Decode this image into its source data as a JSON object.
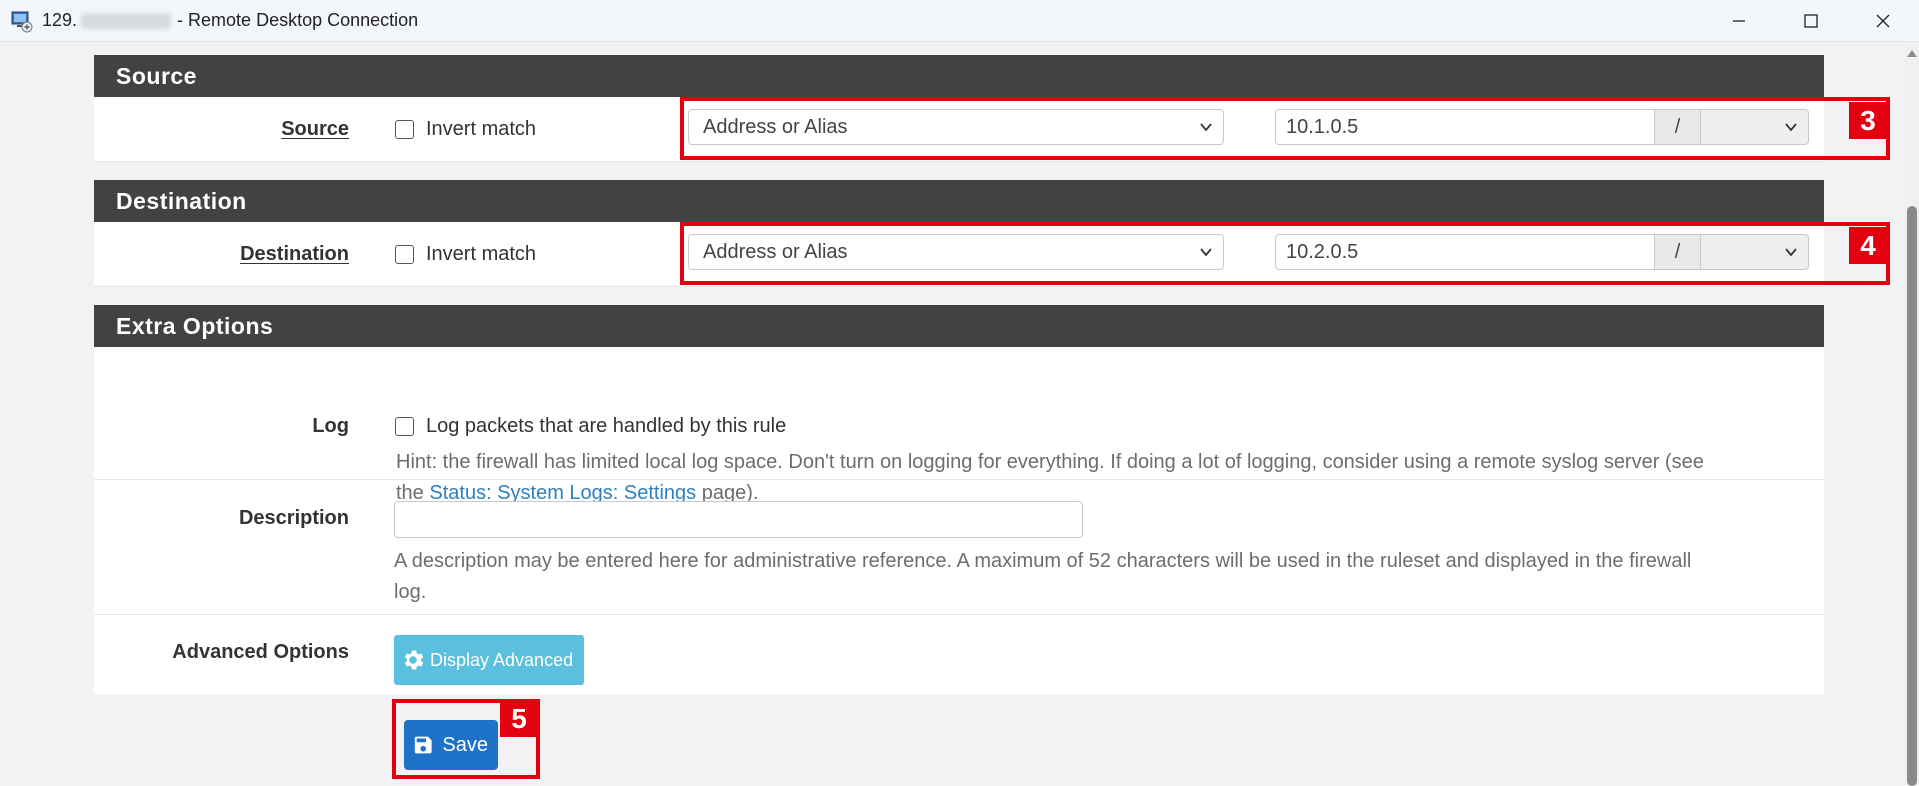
{
  "window": {
    "title_prefix": "129.",
    "title_suffix": "- Remote Desktop Connection"
  },
  "source": {
    "header": "Source",
    "label": "Source",
    "invert_label": "Invert match",
    "type_value": "Address or Alias",
    "address_value": "10.1.0.5",
    "slash": "/",
    "badge": "3"
  },
  "destination": {
    "header": "Destination",
    "label": "Destination",
    "invert_label": "Invert match",
    "type_value": "Address or Alias",
    "address_value": "10.2.0.5",
    "slash": "/",
    "badge": "4"
  },
  "extra": {
    "header": "Extra Options",
    "log_label": "Log",
    "log_checkbox_label": "Log packets that are handled by this rule",
    "log_hint_1": "Hint: the firewall has limited local log space. Don't turn on logging for everything. If doing a lot of logging, consider using a remote syslog server (see",
    "log_hint_the": "the",
    "log_hint_link": "Status: System Logs: Settings",
    "log_hint_end": "page).",
    "description_label": "Description",
    "description_value": "",
    "description_hint_1": "A description may be entered here for administrative reference. A maximum of 52 characters will be used in the ruleset and displayed in the firewall",
    "description_hint_2": "log.",
    "advanced_label": "Advanced Options",
    "advanced_button": "Display Advanced"
  },
  "save": {
    "label": "Save",
    "badge": "5"
  },
  "colors": {
    "panel_header": "#424242",
    "annotation_red": "#e3000f",
    "info_button": "#5bc0de",
    "primary_button": "#1e73c9",
    "link": "#2f7fc1"
  }
}
